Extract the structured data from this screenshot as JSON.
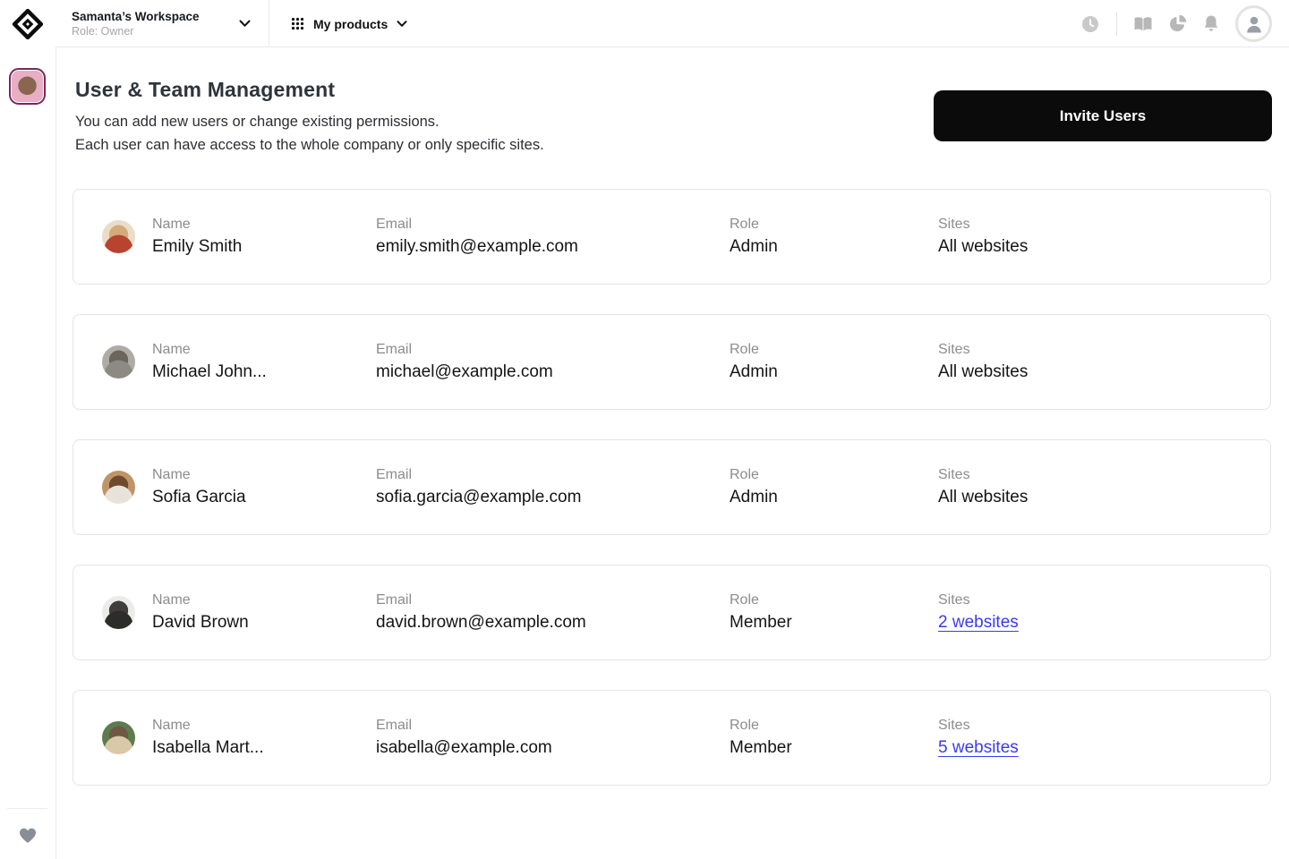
{
  "topbar": {
    "workspace_name": "Samanta’s Workspace",
    "workspace_role": "Role: Owner",
    "products_label": "My products"
  },
  "page": {
    "title": "User & Team Management",
    "subtitle_line1": "You can add new users or change existing permissions.",
    "subtitle_line2": "Each user can have access to the whole company or only specific sites.",
    "invite_button_label": "Invite Users"
  },
  "columns": {
    "name": "Name",
    "email": "Email",
    "role": "Role",
    "sites": "Sites"
  },
  "users": [
    {
      "name": "Emily Smith",
      "email": "emily.smith@example.com",
      "role": "Admin",
      "sites": "All websites",
      "sites_is_link": false,
      "avatar_bg": "#e9dcc8",
      "avatar_subject": "#d3ab7a",
      "avatar_accent": "#b8432e"
    },
    {
      "name": "Michael John...",
      "email": "michael@example.com",
      "role": "Admin",
      "sites": "All websites",
      "sites_is_link": false,
      "avatar_bg": "#aeaca6",
      "avatar_subject": "#6b655c",
      "avatar_accent": "#8d8a83"
    },
    {
      "name": "Sofia Garcia",
      "email": "sofia.garcia@example.com",
      "role": "Admin",
      "sites": "All websites",
      "sites_is_link": false,
      "avatar_bg": "#bf9468",
      "avatar_subject": "#6f4a2f",
      "avatar_accent": "#e8e3da"
    },
    {
      "name": "David Brown",
      "email": "david.brown@example.com",
      "role": "Member",
      "sites": "2 websites",
      "sites_is_link": true,
      "avatar_bg": "#ebebe9",
      "avatar_subject": "#3f3e3c",
      "avatar_accent": "#2c2c2a"
    },
    {
      "name": "Isabella Mart...",
      "email": "isabella@example.com",
      "role": "Member",
      "sites": "5 websites",
      "sites_is_link": true,
      "avatar_bg": "#5d7c4e",
      "avatar_subject": "#6e5844",
      "avatar_accent": "#d9c9a8"
    }
  ],
  "sidebar": {
    "avatar_bg": "#e7aec4",
    "avatar_subject": "#8a6650",
    "avatar_border": "#76295a"
  },
  "colors": {
    "link_blue": "#3a3af1",
    "button_black": "#0b0b0b"
  }
}
